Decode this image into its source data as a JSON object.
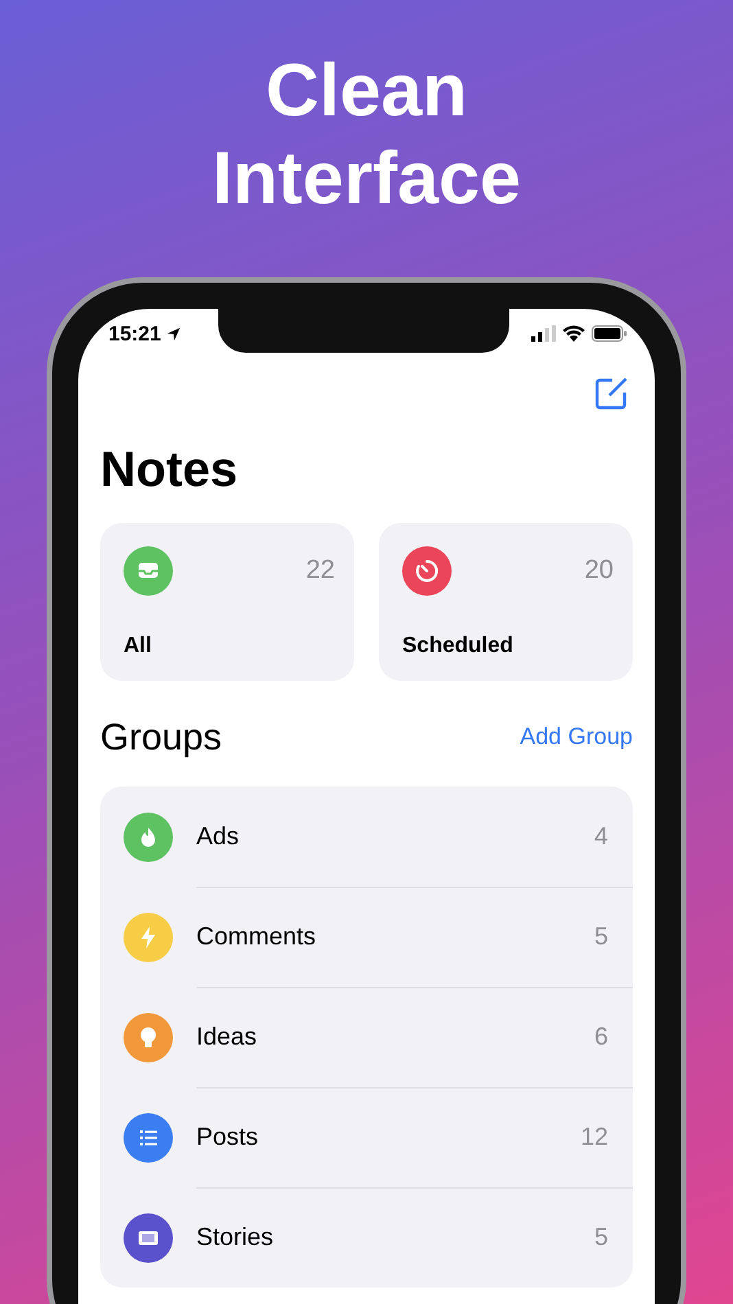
{
  "headline": "Clean Interface",
  "status_bar": {
    "time": "15:21"
  },
  "title": "Notes",
  "cards": [
    {
      "label": "All",
      "count": "22",
      "kind": "inbox",
      "color": "#5ec162"
    },
    {
      "label": "Scheduled",
      "count": "20",
      "kind": "timer",
      "color": "#ea4559"
    }
  ],
  "groups": {
    "title": "Groups",
    "action": "Add Group",
    "items": [
      {
        "name": "Ads",
        "count": "4",
        "kind": "flame",
        "color": "#5ec162"
      },
      {
        "name": "Comments",
        "count": "5",
        "kind": "bolt",
        "color": "#f6cd44"
      },
      {
        "name": "Ideas",
        "count": "6",
        "kind": "bulb",
        "color": "#f0983a"
      },
      {
        "name": "Posts",
        "count": "12",
        "kind": "list",
        "color": "#3a7ef1"
      },
      {
        "name": "Stories",
        "count": "5",
        "kind": "film",
        "color": "#5a52cc"
      }
    ]
  }
}
